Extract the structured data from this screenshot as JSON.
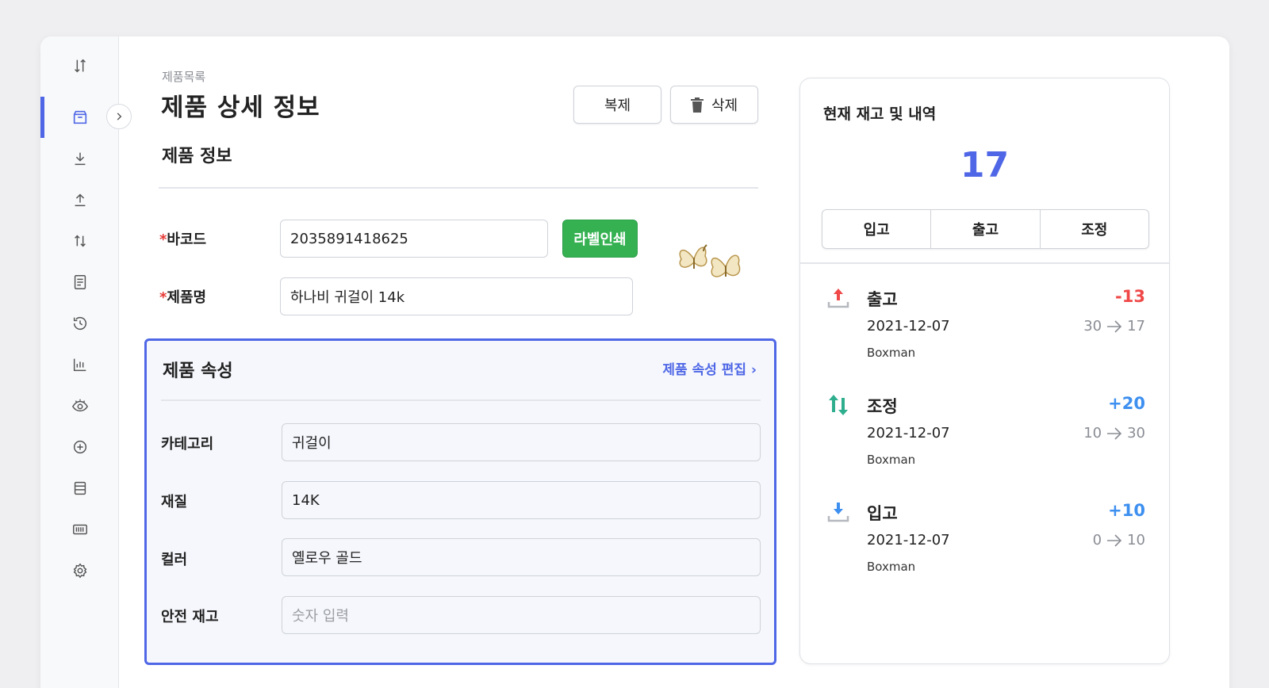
{
  "breadcrumb": "제품목록",
  "page_title": "제품 상세 정보",
  "actions": {
    "duplicate": "복제",
    "delete": "삭제"
  },
  "product_info": {
    "title": "제품 정보",
    "barcode_label": "바코드",
    "barcode_value": "2035891418625",
    "label_print": "라벨인쇄",
    "name_label": "제품명",
    "name_value": "하나비 귀걸이 14k",
    "required_mark": "*"
  },
  "attributes": {
    "title": "제품 속성",
    "edit_link": "제품 속성 편집",
    "category_label": "카테고리",
    "category_value": "귀걸이",
    "material_label": "재질",
    "material_value": "14K",
    "color_label": "컬러",
    "color_value": "옐로우 골드",
    "safety_label": "안전 재고",
    "safety_placeholder": "숫자 입력"
  },
  "stock_panel": {
    "title": "현재 재고 및 내역",
    "count": "17",
    "tabs": [
      "입고",
      "출고",
      "조정"
    ],
    "history": [
      {
        "type": "출고",
        "icon": "upload-arrow-icon",
        "delta": "-13",
        "delta_color": "#f04848",
        "date": "2021-12-07",
        "from": "30",
        "to": "17",
        "user": "Boxman"
      },
      {
        "type": "조정",
        "icon": "adjust-arrows-icon",
        "delta": "+20",
        "delta_color": "#3d8ff0",
        "date": "2021-12-07",
        "from": "10",
        "to": "30",
        "user": "Boxman"
      },
      {
        "type": "입고",
        "icon": "download-arrow-icon",
        "delta": "+10",
        "delta_color": "#3d8ff0",
        "date": "2021-12-07",
        "from": "0",
        "to": "10",
        "user": "Boxman"
      }
    ]
  },
  "colors": {
    "accent": "#4f67e6",
    "green": "#35b152",
    "out": "#f04848",
    "in": "#3d8ff0",
    "adjust": "#2fae8e"
  }
}
